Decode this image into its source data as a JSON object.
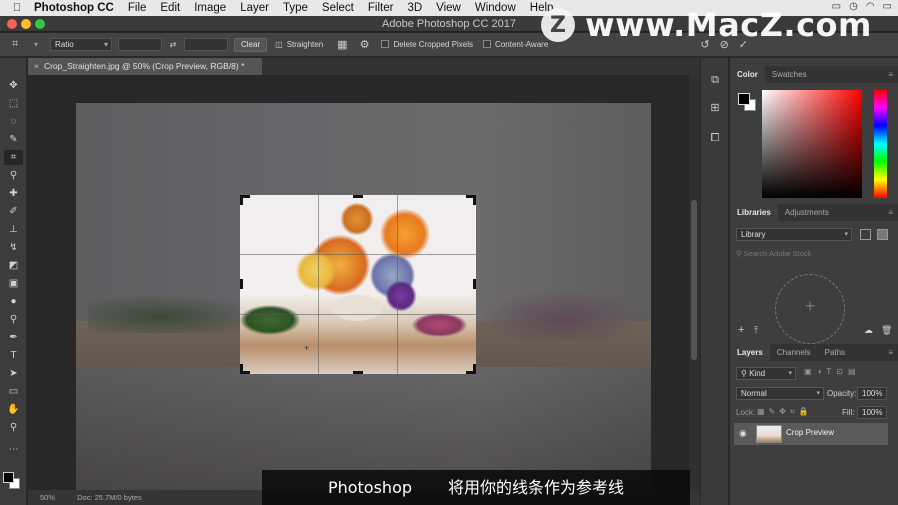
{
  "menubar": {
    "app": "Photoshop CC",
    "items": [
      "File",
      "Edit",
      "Image",
      "Layer",
      "Type",
      "Select",
      "Filter",
      "3D",
      "View",
      "Window",
      "Help"
    ]
  },
  "window": {
    "title": "Adobe Photoshop CC 2017"
  },
  "watermark": {
    "logo": "Z",
    "text": "www.MacZ.com"
  },
  "options": {
    "ratio_label": "Ratio",
    "clear_label": "Clear",
    "straighten_label": "Straighten",
    "delete_cropped_label": "Delete Cropped Pixels",
    "content_aware_label": "Content-Aware"
  },
  "document": {
    "tab_title": "Crop_Straighten.jpg @ 50% (Crop Preview, RGB/8) *",
    "zoom": "50%",
    "doc_size": "Doc: 25.7M/0 bytes"
  },
  "panels": {
    "color_tabs": [
      "Color",
      "Swatches"
    ],
    "library_tabs": [
      "Libraries",
      "Adjustments"
    ],
    "library_select": "Library",
    "stock_search_placeholder": "Search Adobe Stock",
    "layers_tabs": [
      "Layers",
      "Channels",
      "Paths"
    ],
    "kind_label": "Kind",
    "blend_mode": "Normal",
    "opacity_label": "Opacity:",
    "opacity_value": "100%",
    "lock_label": "Lock:",
    "fill_label": "Fill:",
    "fill_value": "100%",
    "layer_name": "Crop Preview"
  },
  "subtitle": {
    "left": "Photoshop",
    "right": "将用你的线条作为参考线"
  }
}
